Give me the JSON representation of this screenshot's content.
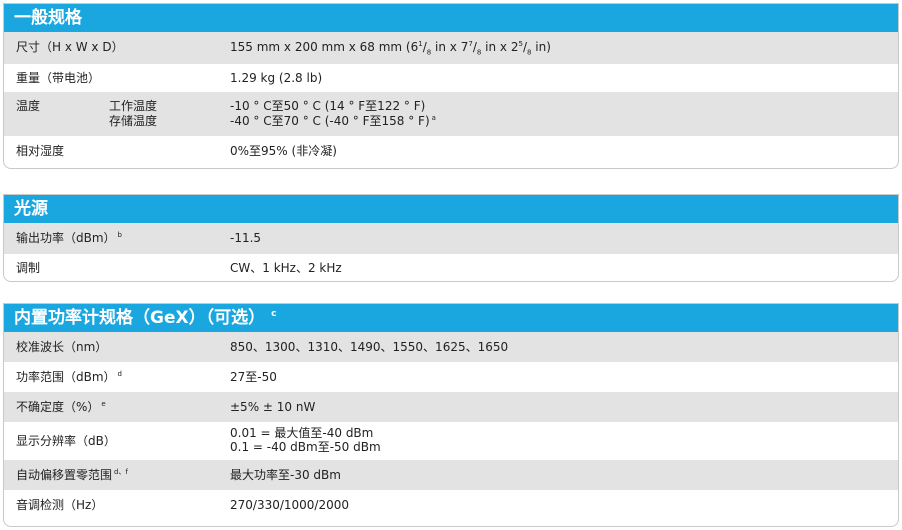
{
  "sections": {
    "general": {
      "title": "一般规格",
      "dimensions": {
        "label": "尺寸（H x W x D）",
        "value_part1": "155 mm x 200 mm x 68 mm (6",
        "frac1_num": "1",
        "frac1_den": "8",
        "value_part2": " in x 7",
        "frac2_num": "7",
        "frac2_den": "8",
        "value_part3": " in x 2",
        "frac3_num": "5",
        "frac3_den": "8",
        "value_part4": " in)"
      },
      "weight": {
        "label": "重量（带电池）",
        "value": "1.29 kg (2.8 lb)"
      },
      "temperature": {
        "label": "温度",
        "operating_label": "工作温度",
        "operating_value": "-10 ° C至50 ° C (14 ° F至122 ° F)",
        "storage_label": "存储温度",
        "storage_value": "-40 ° C至70 ° C (-40 ° F至158 ° F)",
        "storage_footnote": "a"
      },
      "humidity": {
        "label": "相对湿度",
        "value": "0%至95% (非冷凝)"
      }
    },
    "light_source": {
      "title": "光源",
      "output_power": {
        "label": "输出功率（dBm）",
        "footnote": "b",
        "value": "-11.5"
      },
      "modulation": {
        "label": "调制",
        "value": "CW、1 kHz、2 kHz"
      }
    },
    "power_meter": {
      "title": "内置功率计规格（GeX）（可选）",
      "title_footnote": "c",
      "wavelength": {
        "label": "校准波长（nm）",
        "value": "850、1300、1310、1490、1550、1625、1650"
      },
      "power_range": {
        "label": "功率范围（dBm）",
        "footnote": "d",
        "value": "27至-50"
      },
      "uncertainty": {
        "label": "不确定度（%）",
        "footnote": "e",
        "value": "±5% ± 10 nW"
      },
      "resolution": {
        "label": "显示分辨率（dB）",
        "value_line1": "0.01 = 最大值至-40 dBm",
        "value_line2": "0.1 = -40 dBm至-50 dBm"
      },
      "autozero": {
        "label": "自动偏移置零范围",
        "footnote": "d、f",
        "value": "最大功率至-30 dBm"
      },
      "tone_detection": {
        "label": "音调检测（Hz）",
        "value": "270/330/1000/2000"
      }
    }
  },
  "colors": {
    "header_bg": "#1aa7e0",
    "header_text": "#ffffff",
    "row_shade": "#e3e3e3",
    "border": "#c9c9c9"
  }
}
